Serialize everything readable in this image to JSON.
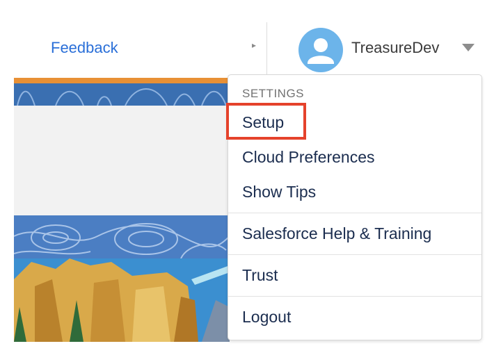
{
  "header": {
    "feedback_label": "Feedback",
    "username": "TreasureDev",
    "avatar_icon": "user-icon",
    "dropdown_icon": "chevron-down-icon"
  },
  "menu": {
    "section_header": "SETTINGS",
    "items": [
      {
        "label": "Setup",
        "highlighted": true
      },
      {
        "label": "Cloud Preferences"
      },
      {
        "label": "Show Tips"
      },
      {
        "label": "Salesforce Help & Training"
      },
      {
        "label": "Trust"
      },
      {
        "label": "Logout"
      }
    ]
  },
  "colors": {
    "link_blue": "#2a6fd8",
    "avatar_blue": "#6cb4ea",
    "highlight_red": "#e5422b",
    "accent_orange": "#e89035"
  }
}
